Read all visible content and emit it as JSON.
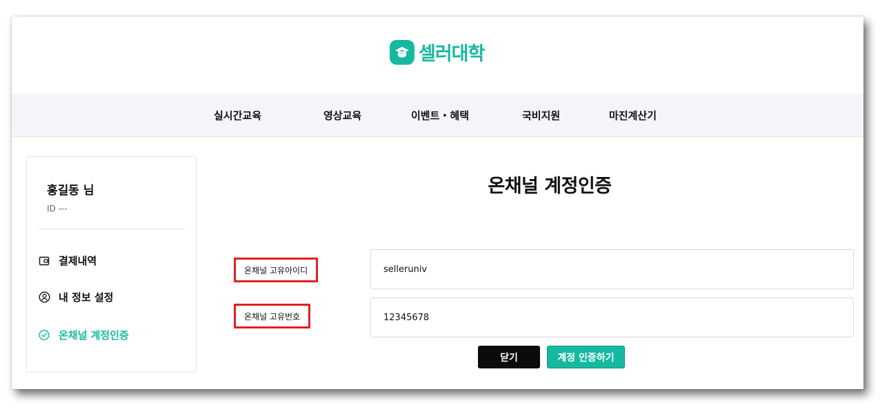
{
  "brand": {
    "name": "셀러대학",
    "color": "#16b9a0",
    "icon": "graduation-cap-icon"
  },
  "nav": {
    "items": [
      {
        "label": "실시간교육"
      },
      {
        "label": "영상교육"
      },
      {
        "label": "이벤트・혜택"
      },
      {
        "label": "국비지원"
      },
      {
        "label": "마진계산기"
      }
    ]
  },
  "sidebar": {
    "user_name": "홍길동 님",
    "user_id": "ID ---",
    "items": [
      {
        "label": "결제내역",
        "icon": "wallet-icon",
        "active": false
      },
      {
        "label": "내 정보 설정",
        "icon": "user-circle-icon",
        "active": false
      },
      {
        "label": "온채널 계정인증",
        "icon": "check-badge-icon",
        "active": true
      }
    ]
  },
  "main": {
    "title": "온채널 계정인증",
    "fields": [
      {
        "label": "온채널 고유아이디",
        "value": "selleruniv"
      },
      {
        "label": "온채널 고유번호",
        "value": "12345678"
      }
    ],
    "close_label": "닫기",
    "verify_label": "계정 인증하기"
  },
  "colors": {
    "accent": "#16b9a0",
    "highlight": "#e02020",
    "nav_bg": "#f4f5f9"
  }
}
